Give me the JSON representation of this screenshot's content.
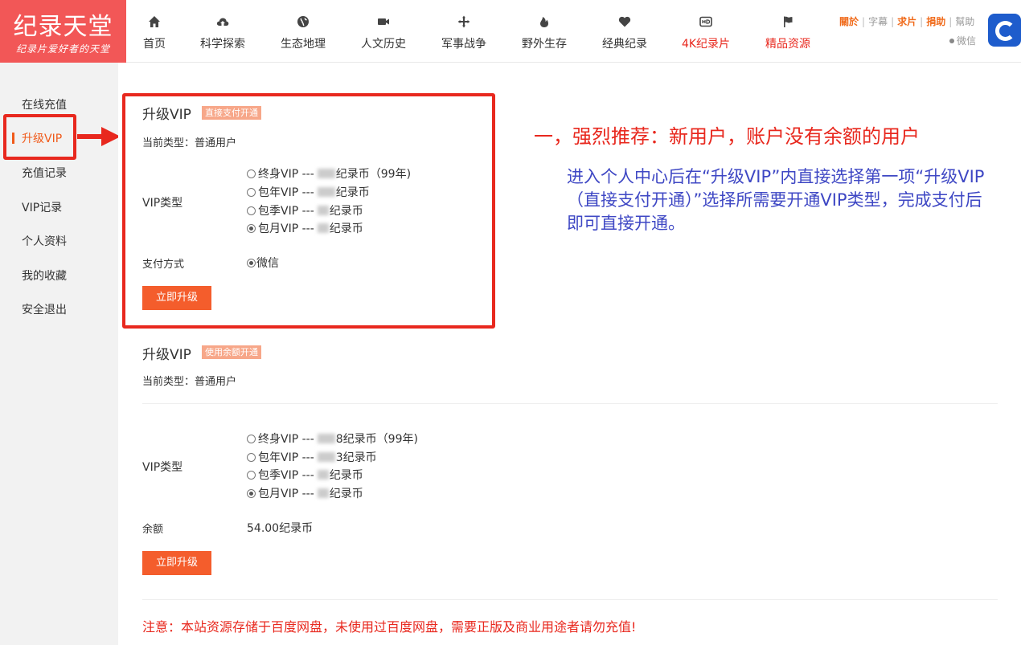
{
  "logo": {
    "title": "纪录天堂",
    "subtitle": "纪录片爱好者的天堂"
  },
  "nav": [
    {
      "label": "首页",
      "icon": "home-icon",
      "red": false
    },
    {
      "label": "科学探索",
      "icon": "cloud-upload-icon",
      "red": false
    },
    {
      "label": "生态地理",
      "icon": "globe-icon",
      "red": false
    },
    {
      "label": "人文历史",
      "icon": "video-camera-icon",
      "red": false
    },
    {
      "label": "军事战争",
      "icon": "crosshair-icon",
      "red": false
    },
    {
      "label": "野外生存",
      "icon": "fire-icon",
      "red": false
    },
    {
      "label": "经典纪录",
      "icon": "heart-icon",
      "red": false
    },
    {
      "label": "4K纪录片",
      "icon": "hd-icon",
      "red": true
    },
    {
      "label": "精品资源",
      "icon": "flag-icon",
      "red": true
    }
  ],
  "toplinks": {
    "about": "關於",
    "subtitles": "字幕",
    "request": "求片",
    "donate": "捐助",
    "help": "幫助",
    "wechat": "微信"
  },
  "sidebar": {
    "items": [
      "在线充值",
      "升级VIP",
      "充值记录",
      "VIP记录",
      "个人资料",
      "我的收藏",
      "安全退出"
    ],
    "active_index": 1
  },
  "section1": {
    "title": "升级VIP",
    "badge": "直接支付开通",
    "current_type_label": "当前类型：普通用户",
    "vip_type_label": "VIP类型",
    "options": [
      {
        "prefix": "终身VIP ---",
        "suffix": "纪录币（99年)",
        "checked": false
      },
      {
        "prefix": "包年VIP ---",
        "suffix": "纪录币",
        "checked": false
      },
      {
        "prefix": "包季VIP ---",
        "suffix": "纪录币",
        "checked": false
      },
      {
        "prefix": "包月VIP ---",
        "suffix": "纪录币",
        "checked": true
      }
    ],
    "pay_label": "支付方式",
    "pay_option": "微信",
    "button": "立即升级"
  },
  "section2": {
    "title": "升级VIP",
    "badge": "使用余额开通",
    "current_type_label": "当前类型：普通用户",
    "vip_type_label": "VIP类型",
    "options": [
      {
        "prefix": "终身VIP ---",
        "suffix": "8纪录币（99年)",
        "checked": false
      },
      {
        "prefix": "包年VIP ---",
        "suffix": "3纪录币",
        "checked": false
      },
      {
        "prefix": "包季VIP ---",
        "suffix": "纪录币",
        "checked": false
      },
      {
        "prefix": "包月VIP ---",
        "suffix": "纪录币",
        "checked": true
      }
    ],
    "balance_label": "余额",
    "balance_value": "54.00纪录币",
    "button": "立即升级"
  },
  "annotation": {
    "title": "一，强烈推荐：新用户，账户没有余额的用户",
    "body": "进入个人中心后在“升级VIP”内直接选择第一项“升级VIP（直接支付开通）”选择所需要开通VIP类型，完成支付后即可直接开通。"
  },
  "notice": "注意：本站资源存储于百度网盘，未使用过百度网盘，需要正版及商业用途者请勿充值!",
  "colors": {
    "brand": "#f25757",
    "accent": "#f45d2c",
    "highlight": "#e8281e",
    "annotation_blue": "#3e47c4"
  }
}
